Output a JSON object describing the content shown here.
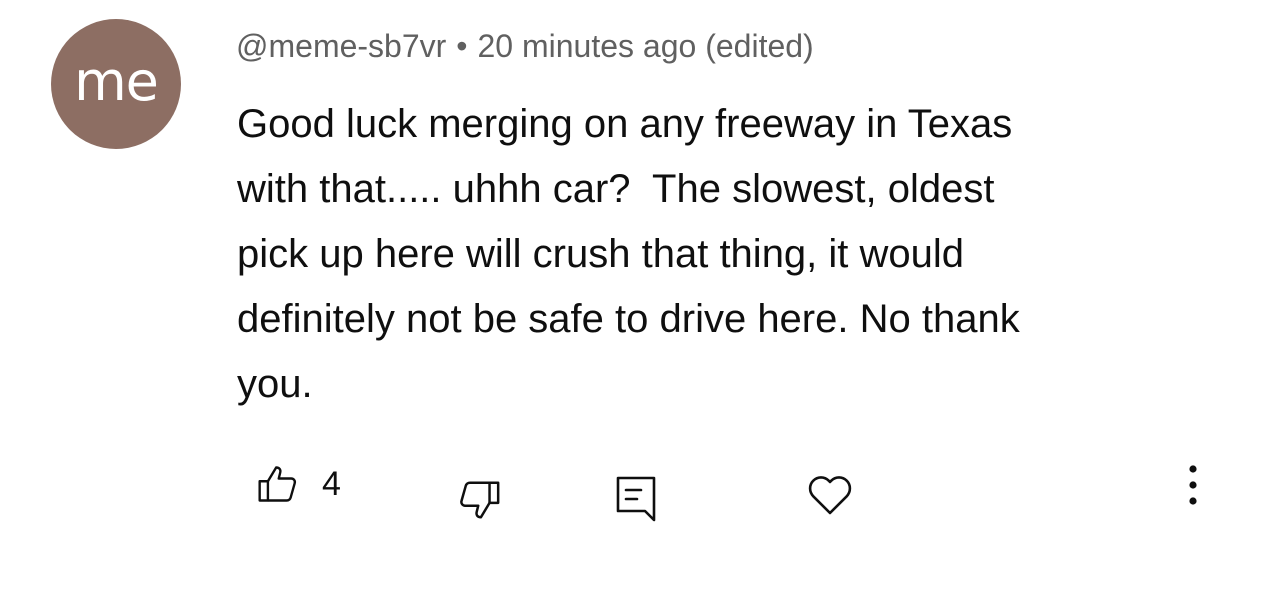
{
  "avatar": {
    "initials": "me",
    "bg_color": "#8d6e63"
  },
  "comment": {
    "author": "@meme-sb7vr",
    "separator": "•",
    "timestamp": "20 minutes ago",
    "edited": "(edited)",
    "lines": [
      "Good luck merging on any freeway in Texas",
      "with that..... uhhh car?  The slowest, oldest",
      "pick up here will crush that thing, it would",
      "definitely not be safe to drive here. No thank",
      "you."
    ]
  },
  "actions": {
    "like_count": "4",
    "like_icon": "thumbs-up-icon",
    "dislike_icon": "thumbs-down-icon",
    "reply_icon": "reply-comment-icon",
    "heart_icon": "heart-icon",
    "more_icon": "more-vertical-icon"
  }
}
